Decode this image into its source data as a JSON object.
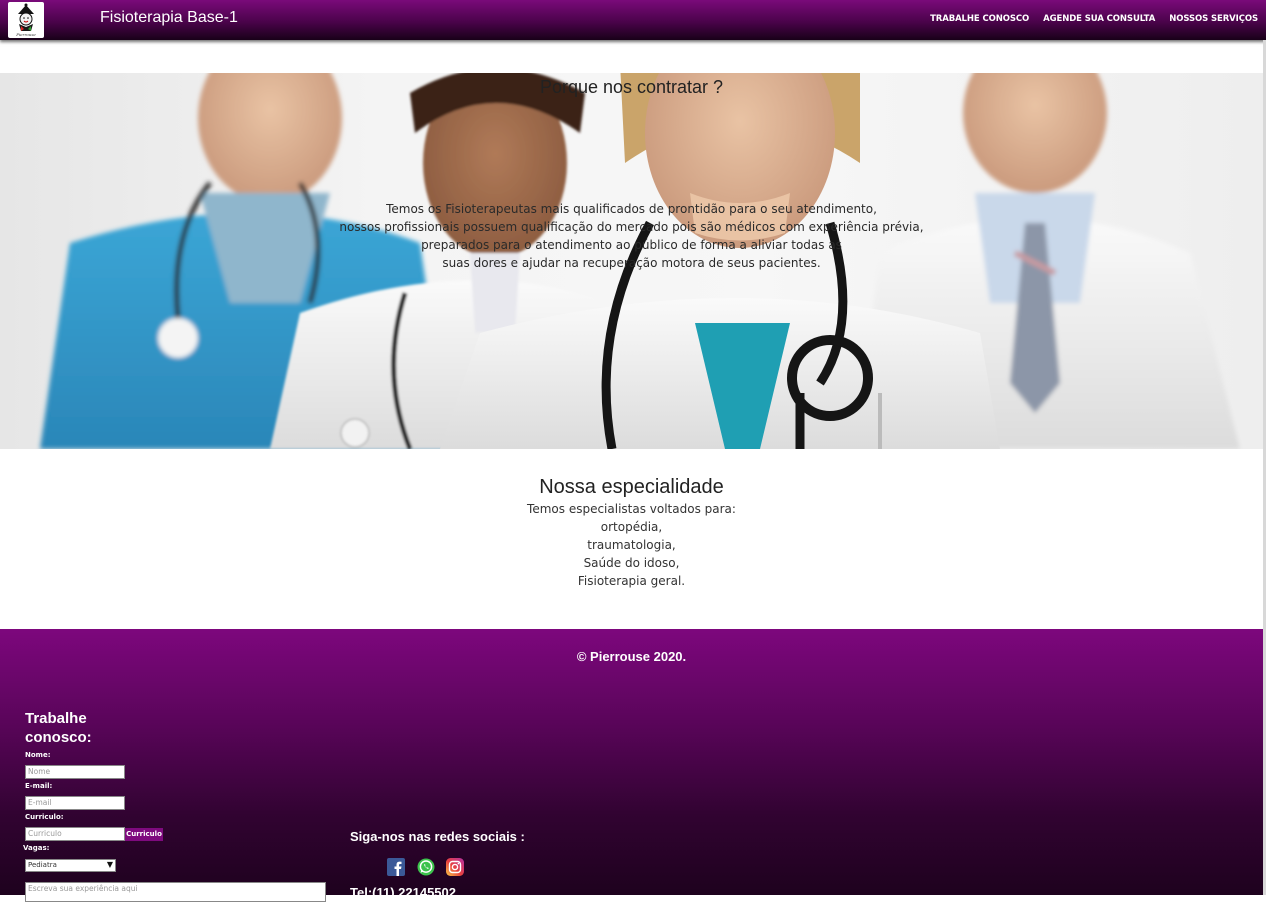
{
  "header": {
    "logo_text": "Pierrouse",
    "brand": "Fisioterapia Base-1",
    "nav": [
      "TRABALHE CONOSCO",
      "AGENDE SUA CONSULTA",
      "NOSSOS SERVIÇOS"
    ]
  },
  "hero": {
    "title": "Porque nos contratar ?",
    "lines": [
      "Temos os Fisioterapeutas mais qualificados de prontidão para o seu atendimento,",
      "nossos profissionais possuem qualificação do mercado pois são médicos com experiência prévia,",
      "preparados para o atendimento ao público de forma a aliviar todas as",
      "suas dores e ajudar na recuperação motora de seus pacientes."
    ]
  },
  "specialty": {
    "title": "Nossa especialidade",
    "lines": [
      "Temos especialistas voltados para:",
      "ortopédia,",
      "traumatologia,",
      "Saúde do idoso,",
      "Fisioterapia geral."
    ]
  },
  "footer": {
    "copyright": "© Pierrouse 2020.",
    "form": {
      "title": "Trabalhe conosco:",
      "name_label": "Nome:",
      "name_placeholder": "Nome",
      "email_label": "E-mail:",
      "email_placeholder": "E-mail",
      "cv_label": "Curriculo:",
      "cv_placeholder": "Curriculo",
      "cv_button": "Curriculo",
      "jobs_label": "Vagas:",
      "jobs_selected": "Pediatra",
      "experience_placeholder": "Escreva sua experiência aqui"
    },
    "social_title": "Siga-nos nas redes sociais :",
    "social_icons": [
      "facebook-icon",
      "whatsapp-icon",
      "instagram-icon"
    ],
    "phone": "Tel:(11) 22145502"
  },
  "colors": {
    "brand_purple": "#7d077d",
    "dark_purple": "#1e021e",
    "button_purple": "#7e0a7e"
  }
}
